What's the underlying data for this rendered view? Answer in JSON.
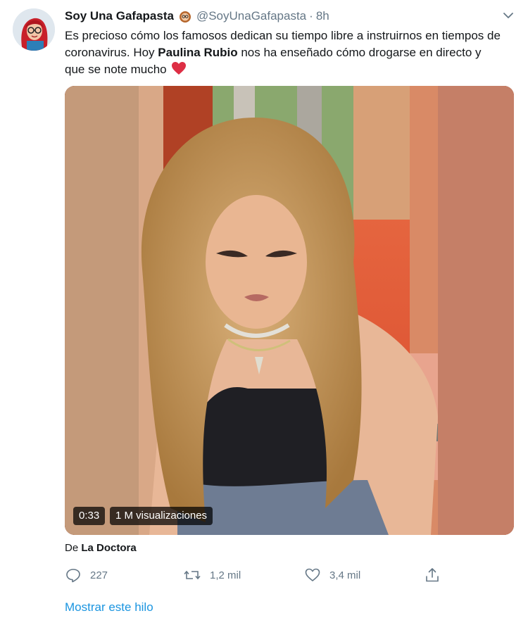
{
  "author": {
    "name": "Soy Una Gafapasta",
    "handle": "@SoyUnaGafapasta",
    "separator": "·",
    "time": "8h"
  },
  "tweet": {
    "text_before": "Es precioso cómo los famosos dedican su tiempo libre a instruirnos en tiempos de coronavirus. Hoy ",
    "text_bold": "Paulina Rubio",
    "text_after": " nos ha enseñado cómo drogarse en directo y que se note mucho"
  },
  "video": {
    "duration": "0:33",
    "views": "1 M visualizaciones"
  },
  "attribution": {
    "prefix": "De",
    "source": "La Doctora"
  },
  "actions": {
    "replies": "227",
    "retweets": "1,2 mil",
    "likes": "3,4 mil"
  },
  "thread_link": "Mostrar este hilo",
  "colors": {
    "accent": "#1b95e0",
    "muted": "#657786",
    "heart": "#e0245e"
  }
}
